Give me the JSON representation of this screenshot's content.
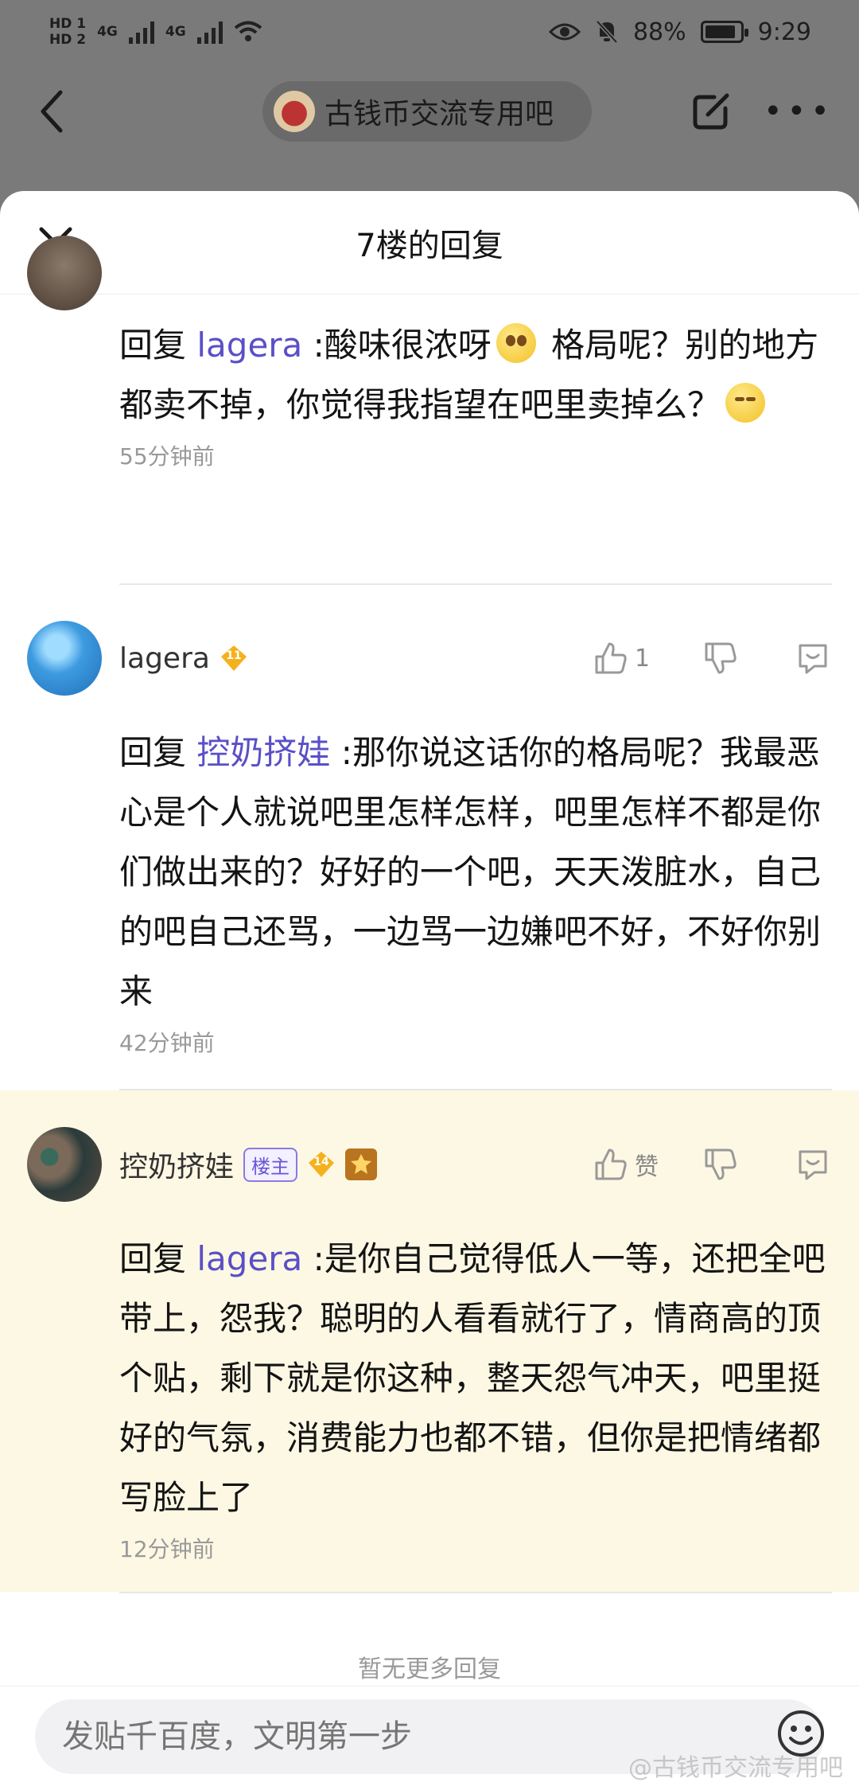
{
  "status_bar": {
    "sim1": "HD 1",
    "sim2": "HD 2",
    "network1": "4G",
    "network2": "4G",
    "battery_percent": "88%",
    "battery_level": 0.88,
    "time": "9:29",
    "icons": [
      "eye-icon",
      "bell-mute-icon",
      "wifi-icon",
      "battery-icon"
    ]
  },
  "background_header": {
    "forum_name": "古钱币交流专用吧"
  },
  "sheet": {
    "title": "7楼的回复"
  },
  "replies": [
    {
      "reply_prefix": "回复",
      "mention": "lagera",
      "text_a": " :酸味很浓呀",
      "text_b": " 格局呢？别的地方都卖不掉，你觉得我指望在吧里卖掉么？",
      "time": "55分钟前"
    },
    {
      "username": "lagera",
      "level": "11",
      "like_count": "1",
      "reply_prefix": "回复",
      "mention": "控奶挤娃",
      "text": " :那你说这话你的格局呢？我最恶心是个人就说吧里怎样怎样，吧里怎样不都是你们做出来的？好好的一个吧，天天泼脏水，自己的吧自己还骂，一边骂一边嫌吧不好，不好你别来",
      "time": "42分钟前"
    },
    {
      "username": "控奶挤娃",
      "owner_badge": "楼主",
      "level": "14",
      "like_label": "赞",
      "reply_prefix": "回复",
      "mention": "lagera",
      "text": " :是你自己觉得低人一等，还把全吧带上，怨我？聪明的人看看就行了，情商高的顶个贴，剩下就是你这种，整天怨气冲天，吧里挺好的气氛，消费能力也都不错，但你是把情绪都写脸上了",
      "time": "12分钟前"
    }
  ],
  "no_more": "暂无更多回复",
  "input": {
    "placeholder": "发贴千百度，文明第一步"
  },
  "watermark": "@古钱币交流专用吧",
  "colors": {
    "mention": "#5b4fc7",
    "highlight_bg": "#fdf8e4",
    "level_badge": "#f5b11c"
  }
}
